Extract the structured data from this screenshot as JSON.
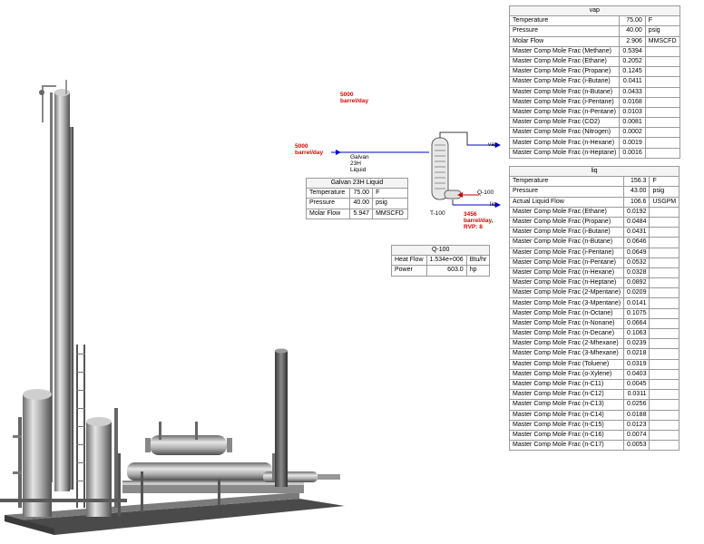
{
  "annotations": {
    "top_rate": [
      "5000",
      "barrel/day"
    ],
    "inlet_rate": [
      "5000",
      "barrel/day"
    ],
    "feed_name": [
      "Galvan",
      "23H",
      "Liquid"
    ],
    "column_label": "T-100",
    "product_rate": [
      "3456",
      "barrel/day,",
      "RVP: 8"
    ],
    "vap_label": "vap",
    "liq_label": "liq",
    "duty_label": "Q-100"
  },
  "galvan_table": {
    "title": "Galvan 23H Liquid",
    "rows": [
      {
        "label": "Temperature",
        "value": "75.00",
        "unit": "F"
      },
      {
        "label": "Pressure",
        "value": "40.00",
        "unit": "psig"
      },
      {
        "label": "Molar Flow",
        "value": "5.947",
        "unit": "MMSCFD"
      }
    ]
  },
  "q100_table": {
    "title": "Q-100",
    "rows": [
      {
        "label": "Heat Flow",
        "value": "1.534e+006",
        "unit": "Btu/hr"
      },
      {
        "label": "Power",
        "value": "603.0",
        "unit": "hp"
      }
    ]
  },
  "vap_table": {
    "title": "vap",
    "rows": [
      {
        "label": "Temperature",
        "value": "75.00",
        "unit": "F"
      },
      {
        "label": "Pressure",
        "value": "40.00",
        "unit": "psig"
      },
      {
        "label": "Molar Flow",
        "value": "2.906",
        "unit": "MMSCFD"
      },
      {
        "label": "Master Comp Mole Frac (Methane)",
        "value": "0.5394",
        "unit": ""
      },
      {
        "label": "Master Comp Mole Frac (Ethane)",
        "value": "0.2052",
        "unit": ""
      },
      {
        "label": "Master Comp Mole Frac (Propane)",
        "value": "0.1245",
        "unit": ""
      },
      {
        "label": "Master Comp Mole Frac (i-Butane)",
        "value": "0.0411",
        "unit": ""
      },
      {
        "label": "Master Comp Mole Frac (n-Butane)",
        "value": "0.0433",
        "unit": ""
      },
      {
        "label": "Master Comp Mole Frac (i-Pentane)",
        "value": "0.0168",
        "unit": ""
      },
      {
        "label": "Master Comp Mole Frac (n-Pentane)",
        "value": "0.0103",
        "unit": ""
      },
      {
        "label": "Master Comp Mole Frac (CO2)",
        "value": "0.0081",
        "unit": ""
      },
      {
        "label": "Master Comp Mole Frac (Nitrogen)",
        "value": "0.0002",
        "unit": ""
      },
      {
        "label": "Master Comp Mole Frac (n-Hexane)",
        "value": "0.0019",
        "unit": ""
      },
      {
        "label": "Master Comp Mole Frac (n-Heptane)",
        "value": "0.0016",
        "unit": ""
      }
    ]
  },
  "liq_table": {
    "title": "liq",
    "rows": [
      {
        "label": "Temperature",
        "value": "156.3",
        "unit": "F"
      },
      {
        "label": "Pressure",
        "value": "43.00",
        "unit": "psig"
      },
      {
        "label": "Actual Liquid Flow",
        "value": "106.6",
        "unit": "USGPM"
      },
      {
        "label": "Master Comp Mole Frac (Ethane)",
        "value": "0.0192",
        "unit": ""
      },
      {
        "label": "Master Comp Mole Frac (Propane)",
        "value": "0.0484",
        "unit": ""
      },
      {
        "label": "Master Comp Mole Frac (i-Butane)",
        "value": "0.0431",
        "unit": ""
      },
      {
        "label": "Master Comp Mole Frac (n-Butane)",
        "value": "0.0646",
        "unit": ""
      },
      {
        "label": "Master Comp Mole Frac (i-Pentane)",
        "value": "0.0649",
        "unit": ""
      },
      {
        "label": "Master Comp Mole Frac (n-Pentane)",
        "value": "0.0532",
        "unit": ""
      },
      {
        "label": "Master Comp Mole Frac (n-Hexane)",
        "value": "0.0328",
        "unit": ""
      },
      {
        "label": "Master Comp Mole Frac (n-Heptane)",
        "value": "0.0892",
        "unit": ""
      },
      {
        "label": "Master Comp Mole Frac (2-Mpentane)",
        "value": "0.0209",
        "unit": ""
      },
      {
        "label": "Master Comp Mole Frac (3-Mpentane)",
        "value": "0.0141",
        "unit": ""
      },
      {
        "label": "Master Comp Mole Frac (n-Octane)",
        "value": "0.1075",
        "unit": ""
      },
      {
        "label": "Master Comp Mole Frac (n-Nonane)",
        "value": "0.0664",
        "unit": ""
      },
      {
        "label": "Master Comp Mole Frac (n-Decane)",
        "value": "0.1063",
        "unit": ""
      },
      {
        "label": "Master Comp Mole Frac (2-Mhexane)",
        "value": "0.0239",
        "unit": ""
      },
      {
        "label": "Master Comp Mole Frac (3-Mhexane)",
        "value": "0.0218",
        "unit": ""
      },
      {
        "label": "Master Comp Mole Frac (Toluene)",
        "value": "0.0319",
        "unit": ""
      },
      {
        "label": "Master Comp Mole Frac (o-Xylene)",
        "value": "0.0403",
        "unit": ""
      },
      {
        "label": "Master Comp Mole Frac (n-C11)",
        "value": "0.0045",
        "unit": ""
      },
      {
        "label": "Master Comp Mole Frac (n-C12)",
        "value": "0.0311",
        "unit": ""
      },
      {
        "label": "Master Comp Mole Frac (n-C13)",
        "value": "0.0256",
        "unit": ""
      },
      {
        "label": "Master Comp Mole Frac (n-C14)",
        "value": "0.0188",
        "unit": ""
      },
      {
        "label": "Master Comp Mole Frac (n-C15)",
        "value": "0.0123",
        "unit": ""
      },
      {
        "label": "Master Comp Mole Frac (n-C16)",
        "value": "0.0074",
        "unit": ""
      },
      {
        "label": "Master Comp Mole Frac (n-C17)",
        "value": "0.0053",
        "unit": ""
      }
    ]
  },
  "colors": {
    "stream_blue": "#0000cc",
    "energy_red": "#cc0000",
    "annotation_red": "#e00000"
  }
}
